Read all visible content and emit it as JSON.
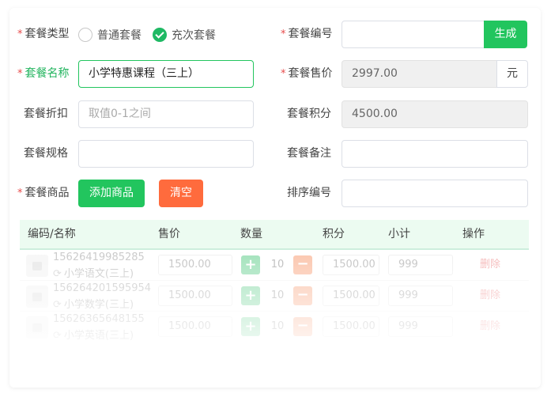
{
  "form": {
    "type_label": "套餐类型",
    "type_options": [
      "普通套餐",
      "充次套餐"
    ],
    "type_selected": "充次套餐",
    "code_label": "套餐编号",
    "code_value": "",
    "generate_label": "生成",
    "name_label": "套餐名称",
    "name_value": "小学特惠课程（三上）",
    "price_label": "套餐售价",
    "price_value": "2997.00",
    "price_unit": "元",
    "discount_label": "套餐折扣",
    "discount_placeholder": "取值0-1之间",
    "points_label": "套餐积分",
    "points_value": "4500.00",
    "spec_label": "套餐规格",
    "spec_value": "",
    "remark_label": "套餐备注",
    "remark_value": "",
    "goods_label": "套餐商品",
    "add_goods_label": "添加商品",
    "clear_label": "清空",
    "sort_label": "排序编号",
    "sort_value": ""
  },
  "table": {
    "headers": [
      "编码/名称",
      "售价",
      "数量",
      "积分",
      "小计",
      "操作"
    ],
    "rows": [
      {
        "code": "15626419985285",
        "name": "小学语文(三上)",
        "price": "1500.00",
        "qty": "10",
        "points": "1500.00",
        "subtotal": "999",
        "action": "删除"
      },
      {
        "code": "15626420159595​4",
        "name": "小学数学(三上)",
        "price": "1500.00",
        "qty": "10",
        "points": "1500.00",
        "subtotal": "999",
        "action": "删除"
      },
      {
        "code": "15626365648155",
        "name": "小学英语(三上)",
        "price": "1500.00",
        "qty": "10",
        "points": "1500.00",
        "subtotal": "999",
        "action": "删除"
      }
    ]
  },
  "colors": {
    "primary": "#22c55e",
    "danger": "#ff6b3d",
    "required": "#e84b4b",
    "header_bg": "#ecfbf1"
  }
}
